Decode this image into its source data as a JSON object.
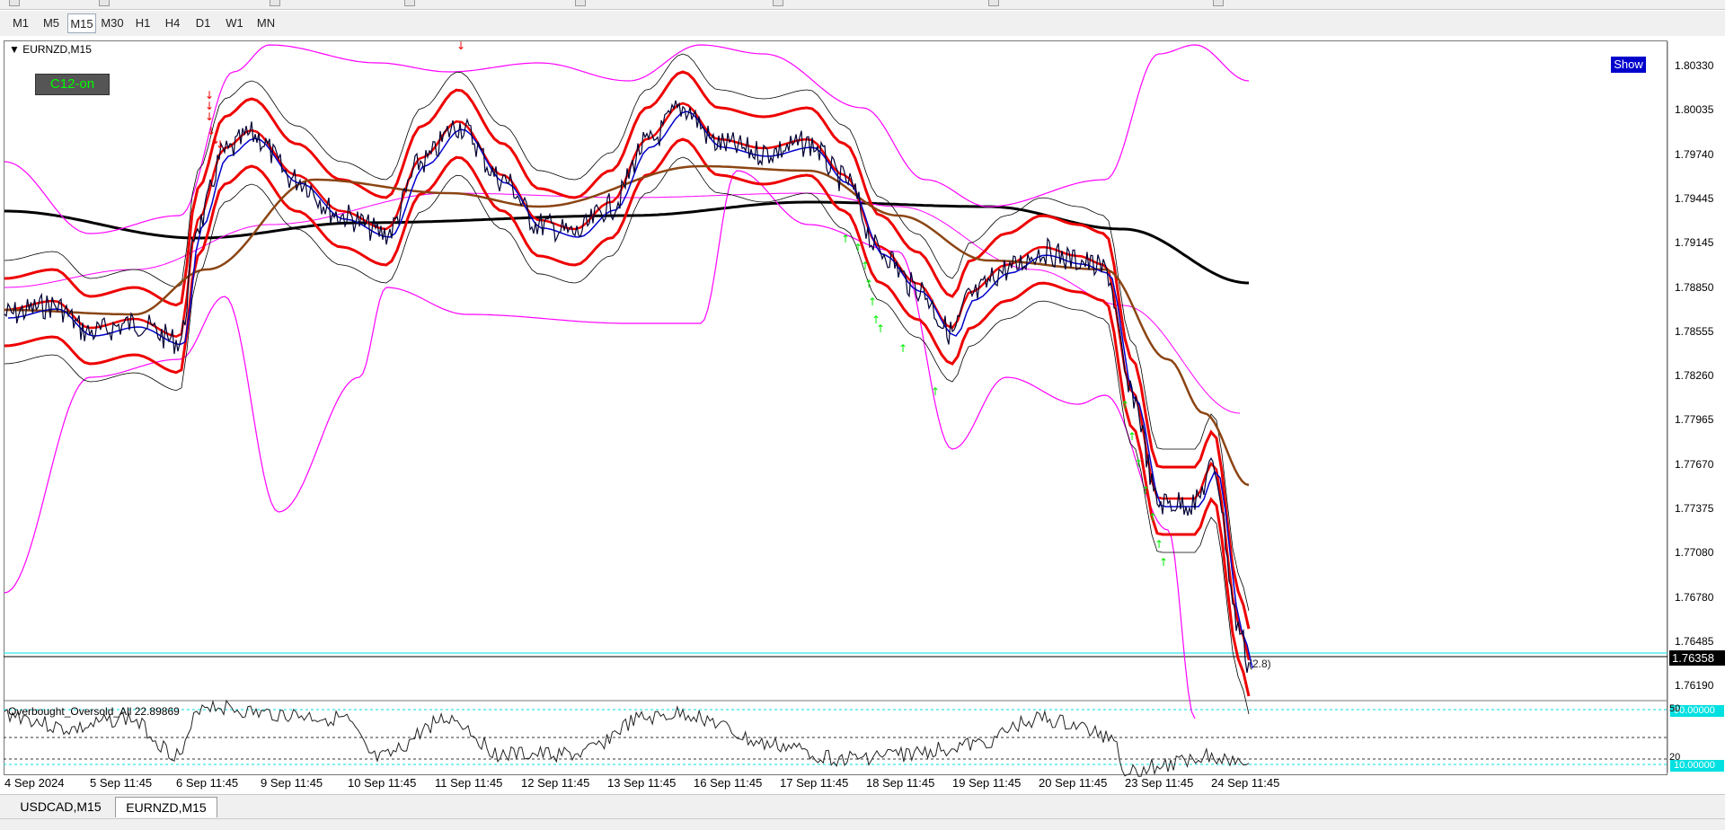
{
  "timeframes": [
    "M1",
    "M5",
    "M15",
    "M30",
    "H1",
    "H4",
    "D1",
    "W1",
    "MN"
  ],
  "active_timeframe": "M15",
  "chart": {
    "symbol_label": "EURNZD,M15",
    "c12_button": "C12-on",
    "show_button": "Show",
    "current_price": "1.76358",
    "price_tag": "(2.8)",
    "price_axis": [
      "1.80330",
      "1.80035",
      "1.79740",
      "1.79445",
      "1.79145",
      "1.78850",
      "1.78555",
      "1.78260",
      "1.77965",
      "1.77670",
      "1.77375",
      "1.77080",
      "1.76780",
      "1.76485",
      "1.76190"
    ],
    "time_axis": [
      "4 Sep 2024",
      "5 Sep 11:45",
      "6 Sep 11:45",
      "9 Sep 11:45",
      "10 Sep 11:45",
      "11 Sep 11:45",
      "12 Sep 11:45",
      "13 Sep 11:45",
      "16 Sep 11:45",
      "17 Sep 11:45",
      "18 Sep 11:45",
      "19 Sep 11:45",
      "20 Sep 11:45",
      "23 Sep 11:45",
      "24 Sep 11:45"
    ]
  },
  "oscillator": {
    "label": "Overbought_Oversold_All 22.89869",
    "level_high": "90.00000",
    "level_mid": "50",
    "level_low_small": "20",
    "level_low": "10.00000"
  },
  "tabs": [
    "USDCAD,M15",
    "EURNZD,M15"
  ],
  "active_tab": "EURNZD,M15",
  "colors": {
    "bollinger_outer": "#ff00ff",
    "bollinger_inner": "#000000",
    "envelope": "#ee0000",
    "ma_fast": "#0000cc",
    "ma_slow": "#8b4513",
    "ma_long": "#000000",
    "price": "#000033",
    "buy_arrows": "#00ee00",
    "sell_arrows": "#ee0000",
    "level_box": "#00e0e0"
  }
}
